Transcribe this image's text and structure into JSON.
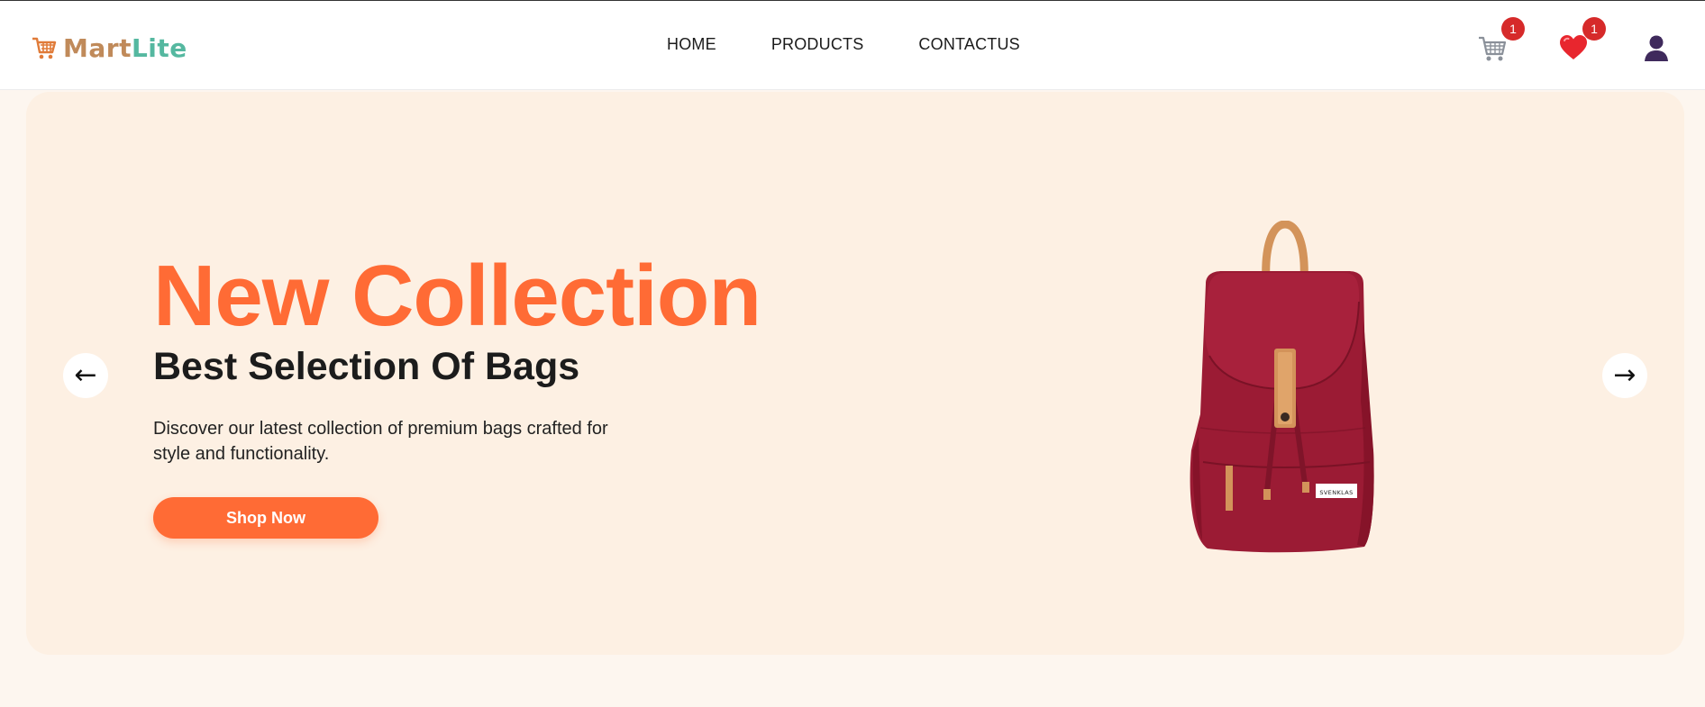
{
  "header": {
    "logo": {
      "part1": "Mart",
      "part2": "Lite",
      "icon": "shopping-cart-icon"
    },
    "nav": [
      {
        "label": "HOME"
      },
      {
        "label": "PRODUCTS"
      },
      {
        "label": "CONTACTUS"
      }
    ],
    "cart": {
      "icon": "shopping-cart-icon",
      "count": "1"
    },
    "wishlist": {
      "icon": "heart-icon",
      "count": "1"
    },
    "profile": {
      "icon": "user-icon"
    }
  },
  "hero": {
    "title": "New Collection",
    "subtitle": "Best Selection Of Bags",
    "description": "Discover our latest collection of premium bags crafted for style and functionality.",
    "cta_label": "Shop Now",
    "prev_label": "←",
    "next_label": "→",
    "image": "red-backpack",
    "bag_tag_text": "SVENKLAS"
  },
  "colors": {
    "accent": "#ff6b35",
    "hero_bg": "#fdf0e3",
    "badge": "#d62a2a",
    "bag": "#9e1b35"
  }
}
